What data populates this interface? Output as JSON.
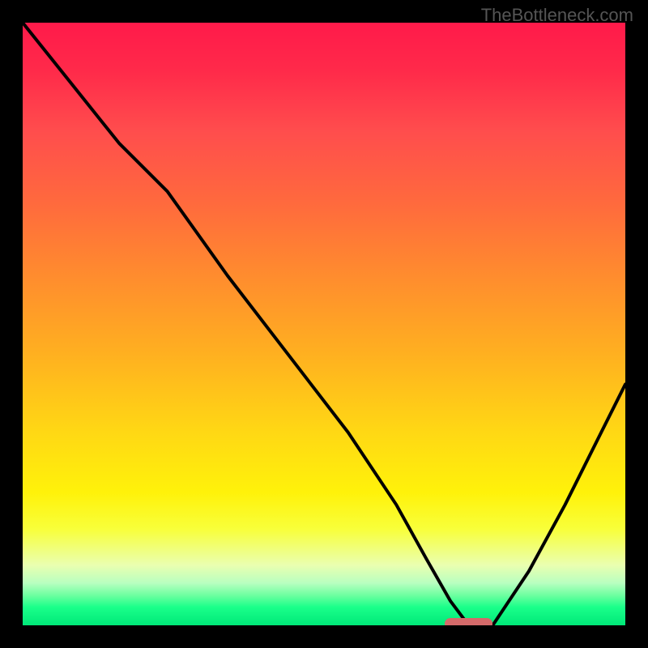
{
  "watermark": "TheBottleneck.com",
  "chart_data": {
    "type": "line",
    "title": "",
    "xlabel": "",
    "ylabel": "",
    "xlim": [
      0,
      100
    ],
    "ylim": [
      0,
      100
    ],
    "grid": false,
    "series": [
      {
        "name": "bottleneck-curve",
        "x": [
          0,
          8,
          16,
          24,
          34,
          44,
          54,
          62,
          67,
          71,
          74,
          78,
          84,
          90,
          96,
          100
        ],
        "y": [
          100,
          90,
          80,
          72,
          58,
          45,
          32,
          20,
          11,
          4,
          0,
          0,
          9,
          20,
          32,
          40
        ]
      }
    ],
    "marker": {
      "x_start": 70,
      "x_end": 78,
      "y": 0
    }
  },
  "colors": {
    "curve": "#000000",
    "marker": "#d46a6a",
    "background": "#000000"
  }
}
